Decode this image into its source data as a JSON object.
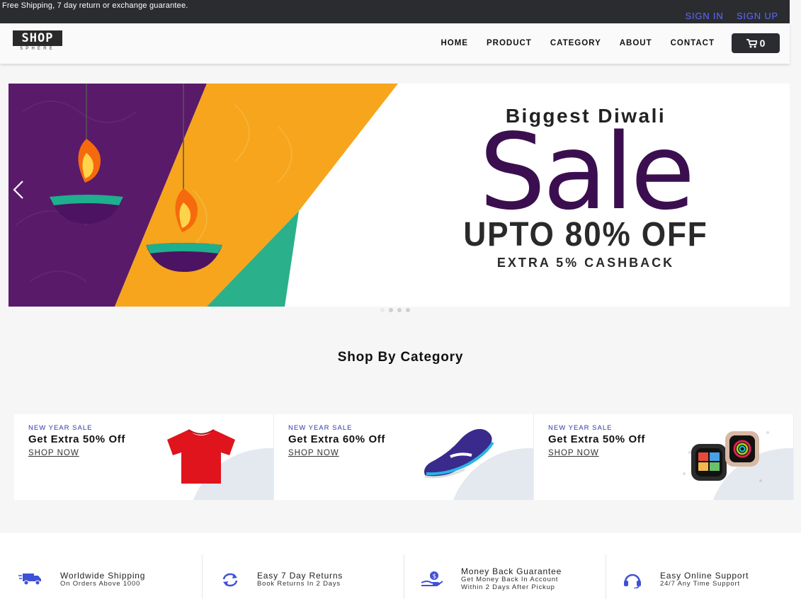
{
  "topbar": {
    "promo": "Free Shipping, 7 day return or exchange guarantee.",
    "sign_in": "SIGN IN",
    "sign_up": "SIGN UP"
  },
  "header": {
    "logo_main": "SHOP",
    "logo_sub": "SPHERE",
    "nav": [
      "HOME",
      "PRODUCT",
      "CATEGORY",
      "ABOUT",
      "CONTACT"
    ],
    "cart_count": "0"
  },
  "hero": {
    "line1": "Biggest Diwali",
    "line2": "Sale",
    "line3": "UPTO 80% OFF",
    "line4": "EXTRA 5% CASHBACK",
    "slide_count": 4,
    "active_slide": 0
  },
  "category": {
    "title": "Shop By Category",
    "cards": [
      {
        "tag": "NEW YEAR SALE",
        "title": "Get Extra 50% Off",
        "cta": "SHOP NOW",
        "product_icon": "tshirt"
      },
      {
        "tag": "NEW YEAR SALE",
        "title": "Get Extra 60% Off",
        "cta": "SHOP NOW",
        "product_icon": "sneaker"
      },
      {
        "tag": "NEW YEAR SALE",
        "title": "Get Extra 50% Off",
        "cta": "SHOP NOW",
        "product_icon": "smartwatch"
      }
    ]
  },
  "features": [
    {
      "title": "Worldwide Shipping",
      "sub": [
        "On Orders Above 1000"
      ],
      "icon": "truck-icon"
    },
    {
      "title": "Easy 7 Day Returns",
      "sub": [
        "Book Returns In 2 Days"
      ],
      "icon": "refresh-icon"
    },
    {
      "title": "Money Back Guarantee",
      "sub": [
        "Get Money Back In Account",
        "Within 2 Days After Pickup"
      ],
      "icon": "money-hand-icon"
    },
    {
      "title": "Easy Online Support",
      "sub": [
        "24/7 Any Time Support"
      ],
      "icon": "headset-icon"
    }
  ],
  "colors": {
    "dark": "#2b2c30",
    "link": "#5b6cff",
    "sale_purple": "#3b0f4f",
    "icon_blue": "#3f51d8"
  }
}
